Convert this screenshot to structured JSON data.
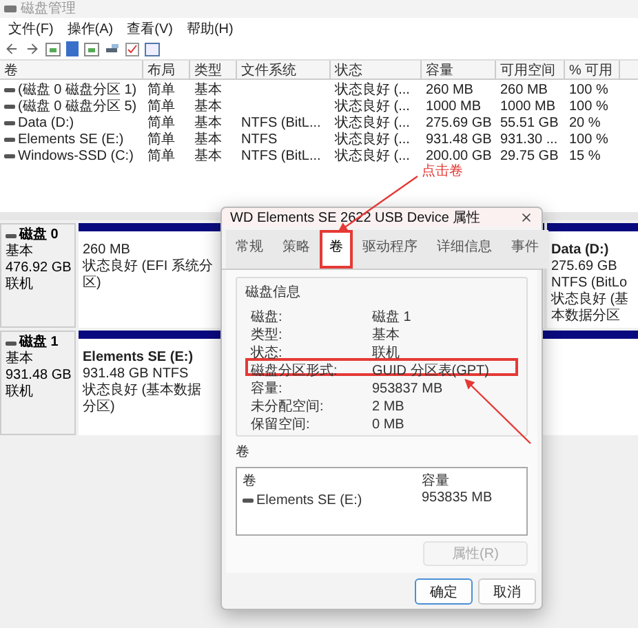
{
  "window": {
    "title": "磁盘管理"
  },
  "menu": [
    "文件(F)",
    "操作(A)",
    "查看(V)",
    "帮助(H)"
  ],
  "volume_table": {
    "columns": [
      "卷",
      "布局",
      "类型",
      "文件系统",
      "状态",
      "容量",
      "可用空间",
      "% 可用"
    ],
    "rows": [
      {
        "cells": [
          "(磁盘 0 磁盘分区 1)",
          "简单",
          "基本",
          "",
          "状态良好 (...",
          "260 MB",
          "260 MB",
          "100 %"
        ]
      },
      {
        "cells": [
          "(磁盘 0 磁盘分区 5)",
          "简单",
          "基本",
          "",
          "状态良好 (...",
          "1000 MB",
          "1000 MB",
          "100 %"
        ]
      },
      {
        "cells": [
          "Data (D:)",
          "简单",
          "基本",
          "NTFS (BitL...",
          "状态良好 (...",
          "275.69 GB",
          "55.51 GB",
          "20 %"
        ]
      },
      {
        "cells": [
          "Elements SE (E:)",
          "简单",
          "基本",
          "NTFS",
          "状态良好 (...",
          "931.48 GB",
          "931.30 ...",
          "100 %"
        ]
      },
      {
        "cells": [
          "Windows-SSD (C:)",
          "简单",
          "基本",
          "NTFS (BitL...",
          "状态良好 (...",
          "200.00 GB",
          "29.75 GB",
          "15 %"
        ]
      }
    ]
  },
  "disks": [
    {
      "name": "磁盘 0",
      "type": "基本",
      "size": "476.92 GB",
      "status": "联机",
      "partitions": [
        {
          "size_fs": "260 MB",
          "status": "状态良好 (EFI 系统分区)"
        },
        {
          "title": "Data  (D:)",
          "size_fs": "275.69 GB NTFS (BitLo",
          "status": "状态良好 (基本数据分区"
        }
      ]
    },
    {
      "name": "磁盘 1",
      "type": "基本",
      "size": "931.48 GB",
      "status": "联机",
      "partitions": [
        {
          "title": "Elements SE  (E:)",
          "size_fs": "931.48 GB NTFS",
          "status": "状态良好 (基本数据分区)"
        }
      ]
    }
  ],
  "dialog": {
    "title": "WD Elements SE 2622 USB Device 属性",
    "tabs": [
      {
        "label": "常规",
        "selected": false,
        "highlighted": false
      },
      {
        "label": "策略",
        "selected": false,
        "highlighted": false
      },
      {
        "label": "卷",
        "selected": true,
        "highlighted": true
      },
      {
        "label": "驱动程序",
        "selected": false,
        "highlighted": false
      },
      {
        "label": "详细信息",
        "selected": false,
        "highlighted": false
      },
      {
        "label": "事件",
        "selected": false,
        "highlighted": false
      }
    ],
    "disk_info": {
      "title": "磁盘信息",
      "rows": [
        {
          "label": "磁盘:",
          "value": "磁盘 1",
          "highlighted": false
        },
        {
          "label": "类型:",
          "value": "基本",
          "highlighted": false
        },
        {
          "label": "状态:",
          "value": "联机",
          "highlighted": false
        },
        {
          "label": "磁盘分区形式:",
          "value": "GUID 分区表(GPT)",
          "highlighted": true
        },
        {
          "label": "容量:",
          "value": "953837 MB",
          "highlighted": false
        },
        {
          "label": "未分配空间:",
          "value": "2 MB",
          "highlighted": false
        },
        {
          "label": "保留空间:",
          "value": "0 MB",
          "highlighted": false
        }
      ]
    },
    "volumes": {
      "title": "卷",
      "columns": [
        "卷",
        "容量"
      ],
      "rows": [
        {
          "cells": [
            "Elements SE (E:)",
            "953835 MB"
          ]
        }
      ]
    },
    "properties_button": {
      "label": "属性(R)",
      "disabled": true
    },
    "buttons": [
      {
        "label": "确定",
        "default": true
      },
      {
        "label": "取消",
        "default": false
      }
    ]
  },
  "annotations": [
    {
      "kind": "note",
      "text": "点击卷"
    }
  ]
}
